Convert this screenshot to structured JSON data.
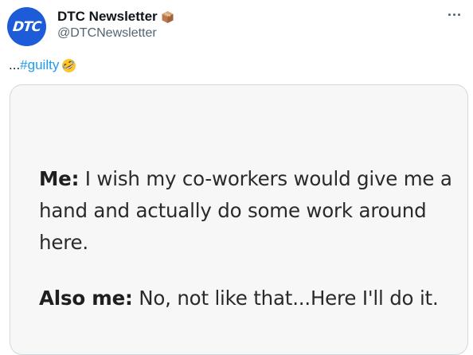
{
  "author": {
    "display_name": "DTC Newsletter",
    "handle": "@DTCNewsletter",
    "avatar_text": "DTC",
    "badge_icon": "package-box-icon",
    "avatar_color": "#1d5bd8"
  },
  "actions": {
    "more_icon": "more-horizontal-icon"
  },
  "tweet": {
    "text_prefix": "...",
    "hashtag": "#guilty",
    "emoji_icon": "rolling-on-floor-laughing-icon"
  },
  "media": {
    "line1_speaker": "Me:",
    "line1_text": " I wish my co-workers would give me a hand and actually do some work around here.",
    "line2_speaker": "Also me:",
    "line2_text": " No, not like that...Here I'll do it."
  },
  "colors": {
    "link": "#1d9bf0",
    "secondary_text": "#536471",
    "primary_text": "#0f1419",
    "border": "#cfd9de"
  }
}
